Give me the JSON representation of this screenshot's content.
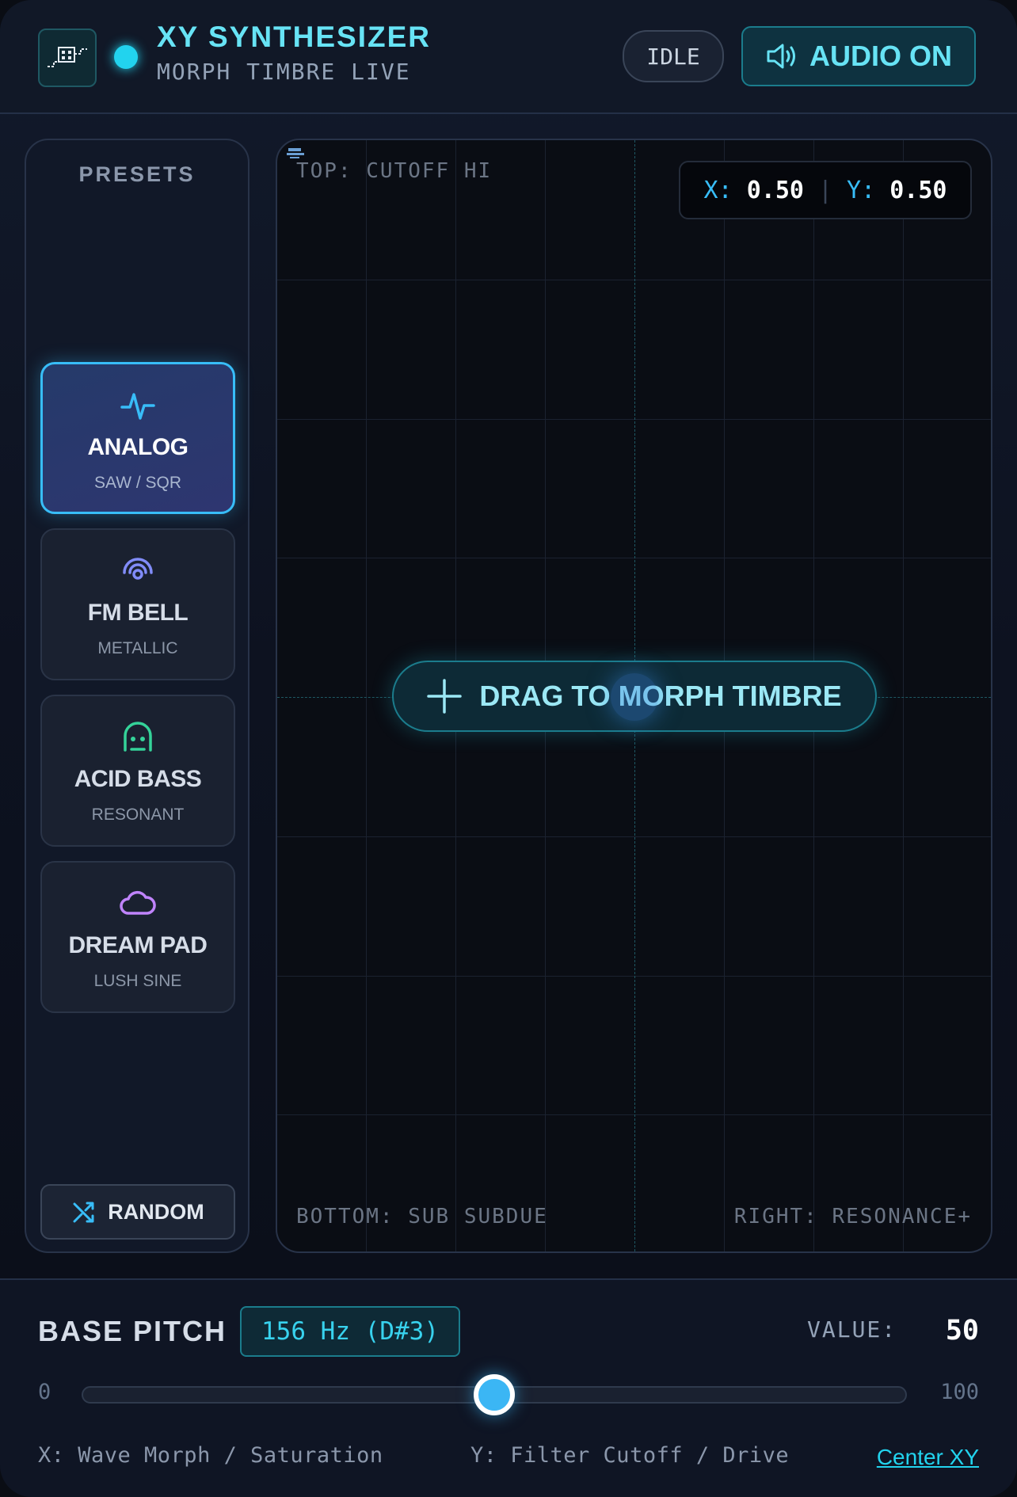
{
  "header": {
    "title": "XY SYNTHESIZER",
    "subtitle": "MORPH TIMBRE LIVE",
    "status": "IDLE",
    "audio_label": "AUDIO ON",
    "accent_color": "#22d3ee"
  },
  "presets": {
    "title": "PRESETS",
    "items": [
      {
        "name": "ANALOG",
        "sub": "SAW / SQR",
        "icon": "waveform-icon",
        "active": true
      },
      {
        "name": "FM BELL",
        "sub": "METALLIC",
        "icon": "broadcast-icon",
        "active": false
      },
      {
        "name": "ACID BASS",
        "sub": "RESONANT",
        "icon": "ghost-icon",
        "active": false
      },
      {
        "name": "DREAM PAD",
        "sub": "LUSH SINE",
        "icon": "cloud-icon",
        "active": false
      }
    ],
    "random_label": "RANDOM"
  },
  "xy_pad": {
    "top_label": "TOP: CUTOFF HI",
    "bottom_label": "BOTTOM: SUB SUBDUE",
    "right_label": "RIGHT: RESONANCE+",
    "x_key": "X:",
    "x_value": "0.50",
    "y_key": "Y:",
    "y_value": "0.50",
    "separator": "|",
    "drag_hint": "DRAG TO MORPH TIMBRE"
  },
  "controls": {
    "base_pitch_label": "BASE PITCH",
    "frequency": "156 Hz (D#3)",
    "value_label": "VALUE:",
    "value": "50",
    "min": "0",
    "max": "100",
    "slider_fraction": 0.5,
    "x_help": "X: Wave Morph / Saturation",
    "y_help": "Y: Filter Cutoff / Drive",
    "center_link": "Center XY"
  }
}
